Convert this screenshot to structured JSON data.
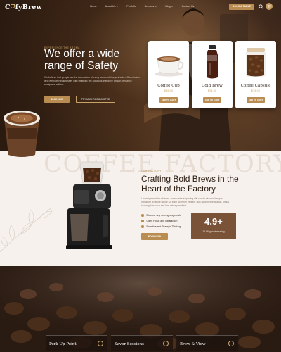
{
  "brand": {
    "name_start": "C",
    "name_end": "fyBrew"
  },
  "nav": [
    {
      "label": "Home"
    },
    {
      "label": "About Us ⌄"
    },
    {
      "label": "Portfolio"
    },
    {
      "label": "Services ⌄"
    },
    {
      "label": "Blog ⌄"
    },
    {
      "label": "Contact Us"
    }
  ],
  "header": {
    "book_label": "BOOK A TABLE"
  },
  "hero": {
    "eyebrow": "EXPERIENCE THE AROMA",
    "title": "We offer a wide range of Safety",
    "description": "We believe that people are the foundation of every successful organization. Our mission is to empower businesses with strategic HR solutions that drive growth, enhance workplace culture.",
    "book_label": "BOOK NOW",
    "try_label": "TRY MUSHROOM COFFEE"
  },
  "products": [
    {
      "name": "Coffee Cup",
      "price": "$39.00",
      "button": "ADD TO CART",
      "icon": "coffee-cup"
    },
    {
      "name": "Cold Brew",
      "price": "$24.00",
      "button": "ADD TO CART",
      "icon": "cold-brew-bottle"
    },
    {
      "name": "Coffee Capsule",
      "price": "$19.00",
      "button": "ADD TO CART",
      "icon": "coffee-bean-jar"
    }
  ],
  "factory": {
    "watermark": "COFFEE FACTORY",
    "eyebrow": "OUR FACTORY",
    "title": "Crafting Bold Brews in the Heart of the Factory",
    "description": "Lorem ipsum dolor sit amet, consectetur adipiscing elit, sed do eiusmod tempor incididunt ut labore dolore. Ut enim ad minim veniam, quis nostrud exercitation. Minus id non gillum locus sed lace rebus poenitent.",
    "features": [
      "Discover any running single cafe",
      "Client Focus and Satisfaction",
      "Proactive and Strategic Thinking"
    ],
    "button": "BOOK NOW",
    "rating_value": "4.9+",
    "rating_label": "15.5K genuine rating"
  },
  "bottom_features": [
    {
      "label": "Perk Up Point"
    },
    {
      "label": "Savor Sessions"
    },
    {
      "label": "Brew & View"
    }
  ]
}
